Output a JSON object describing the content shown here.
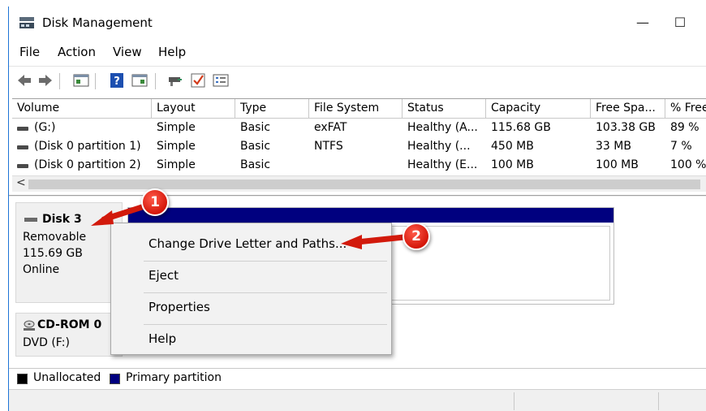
{
  "window": {
    "title": "Disk Management",
    "minimize": "—",
    "maximize": "☐"
  },
  "menu": [
    "File",
    "Action",
    "View",
    "Help"
  ],
  "toolbar_icons": [
    "back-arrow-icon",
    "forward-arrow-icon",
    "console-tree-icon",
    "help-icon",
    "properties-icon",
    "connect-icon",
    "check-icon",
    "list-icon"
  ],
  "volumes": {
    "columns": [
      "Volume",
      "Layout",
      "Type",
      "File System",
      "Status",
      "Capacity",
      "Free Spa...",
      "% Free"
    ],
    "rows": [
      [
        "(G:)",
        "Simple",
        "Basic",
        "exFAT",
        "Healthy (A...",
        "115.68 GB",
        "103.38 GB",
        "89 %"
      ],
      [
        "(Disk 0 partition 1)",
        "Simple",
        "Basic",
        "NTFS",
        "Healthy (...",
        "450 MB",
        "33 MB",
        "7 %"
      ],
      [
        "(Disk 0 partition 2)",
        "Simple",
        "Basic",
        "",
        "Healthy (E...",
        "100 MB",
        "100 MB",
        "100 %"
      ]
    ],
    "scroll_left": "<"
  },
  "disk3": {
    "name": "Disk 3",
    "type": "Removable",
    "size": "115.69 GB",
    "status": "Online"
  },
  "cdrom": {
    "name": "CD-ROM 0",
    "drive": "DVD (F:)"
  },
  "legend": {
    "unallocated": "Unallocated",
    "primary": "Primary partition",
    "unallocated_color": "#000000",
    "primary_color": "#00007f"
  },
  "context_menu": {
    "items": [
      "Change Drive Letter and Paths...",
      "Eject",
      "Properties",
      "Help"
    ]
  },
  "callouts": {
    "one": "1",
    "two": "2"
  }
}
